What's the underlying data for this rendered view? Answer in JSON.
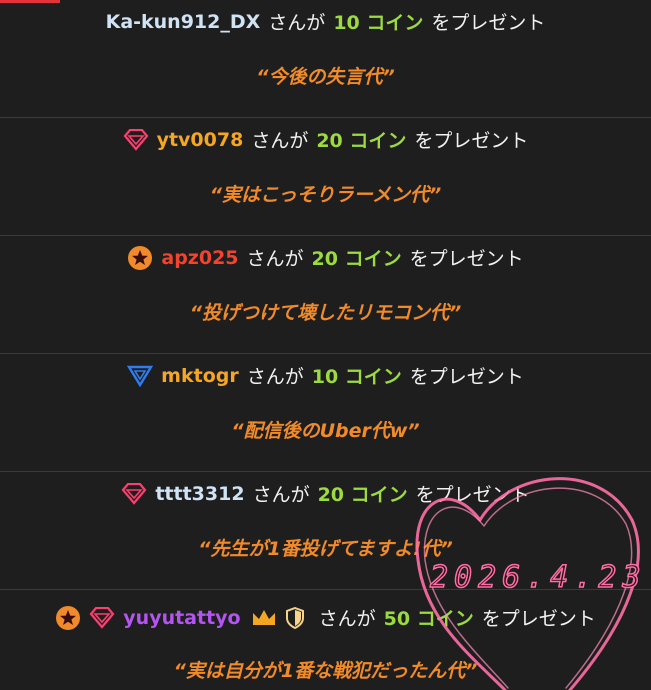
{
  "colors": {
    "accent": "#9bdb3f",
    "message": "#f08a2a",
    "heart": "#ff6fa5"
  },
  "common": {
    "action": "をプレゼント"
  },
  "entries": [
    {
      "user": "Ka-kun912_DX",
      "user_color": "#cfe3f5",
      "connector": "さんが",
      "amount": "10 コイン",
      "message": "“今後の失言代”",
      "icons": []
    },
    {
      "user": "ytv0078",
      "user_color": "#f5a623",
      "connector": "さんが",
      "amount": "20 コイン",
      "message": "“実はこっそりラーメン代”",
      "icons": [
        "diamond-icon"
      ]
    },
    {
      "user": "apz025",
      "user_color": "#f2432f",
      "connector": "さんが",
      "amount": "20 コイン",
      "message": "“投げつけて壊したリモコン代”",
      "icons": [
        "star-badge-icon"
      ]
    },
    {
      "user": "mktogr",
      "user_color": "#f5a623",
      "connector": "さんが",
      "amount": "10 コイン",
      "message": "“配信後のUber代w”",
      "icons": [
        "triangle-icon"
      ]
    },
    {
      "user": "tttt3312",
      "user_color": "#cfe3f5",
      "connector": "さんが",
      "amount": "20 コイン",
      "message": "“先生が1番投げてますよ!代”",
      "icons": [
        "diamond-icon"
      ]
    },
    {
      "user": "yuyutattyo",
      "user_color": "#b455f0",
      "connector": "さんが",
      "amount": "50 コイン",
      "message": "“実は自分が1番な戦犯だったん代”",
      "icons": [
        "star-badge-icon",
        "diamond-icon"
      ],
      "badges": [
        "crown-icon",
        "shield-icon"
      ]
    }
  ],
  "stamp": {
    "date": "2026.4.23"
  }
}
